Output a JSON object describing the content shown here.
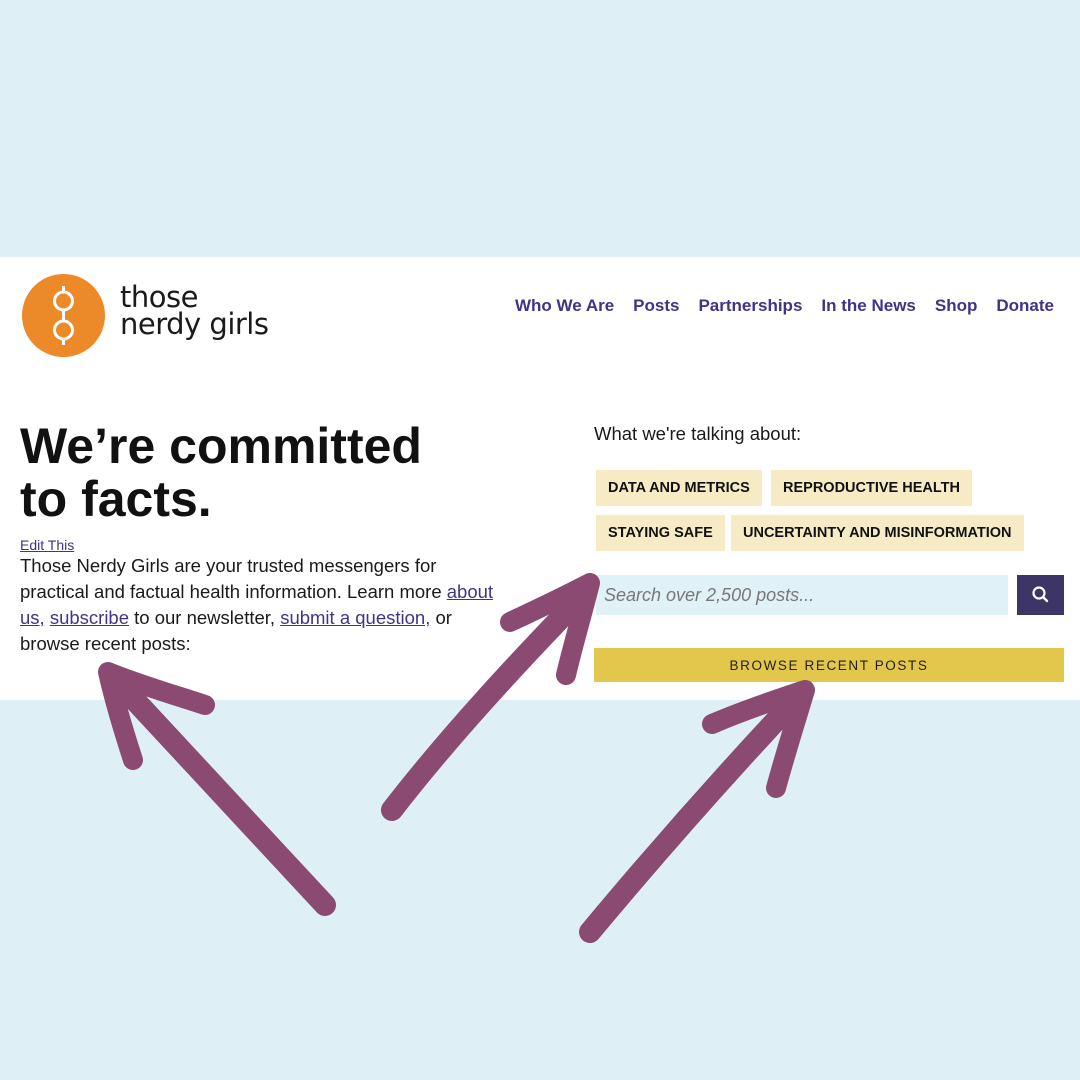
{
  "brand": {
    "name_line1": "those",
    "name_line2": "nerdy girls",
    "logo_color": "#ec8a2a",
    "accent_color": "#3e3489"
  },
  "nav": {
    "items": [
      "Who We Are",
      "Posts",
      "Partnerships",
      "In the News",
      "Shop",
      "Donate"
    ]
  },
  "hero": {
    "headline_line1": "We’re committed",
    "headline_line2": "to facts.",
    "edit_link": "Edit This",
    "intro_part1": "Those Nerdy Girls are your trusted messengers for practical and factual health information. Learn more ",
    "link_about": "about us,",
    "intro_part2": " ",
    "link_subscribe": "subscribe",
    "intro_part3": " to our newsletter, ",
    "link_submit": "submit a question,",
    "intro_part4": " or browse recent posts:"
  },
  "topics": {
    "heading": "What we're talking about:",
    "tags": [
      "DATA AND METRICS",
      "REPRODUCTIVE HEALTH",
      "STAYING SAFE",
      "UNCERTAINTY AND MISINFORMATION"
    ]
  },
  "search": {
    "placeholder": "Search over 2,500 posts...",
    "icon": "search-icon"
  },
  "browse": {
    "label": "BROWSE RECENT POSTS"
  },
  "annotations": {
    "arrow_color": "#8a4a72"
  }
}
